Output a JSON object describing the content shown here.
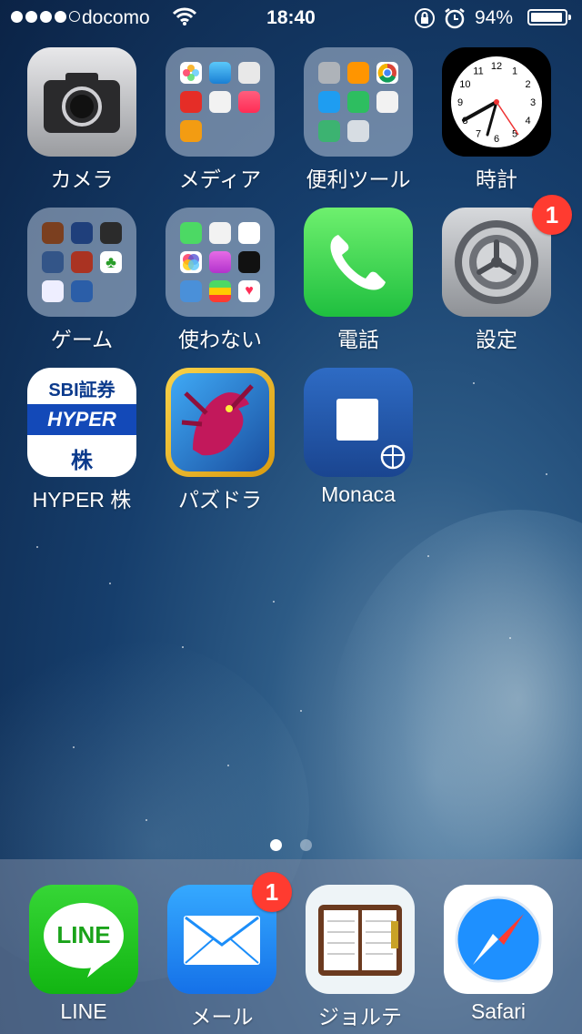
{
  "status_bar": {
    "carrier": "docomo",
    "time": "18:40",
    "battery_percent": "94%",
    "battery_level": 0.94
  },
  "home": {
    "apps": [
      {
        "label": "カメラ",
        "icon": "camera-icon"
      },
      {
        "label": "メディア",
        "icon": "folder-icon"
      },
      {
        "label": "便利ツール",
        "icon": "folder-icon"
      },
      {
        "label": "時計",
        "icon": "clock-icon"
      },
      {
        "label": "ゲーム",
        "icon": "folder-icon"
      },
      {
        "label": "使わない",
        "icon": "folder-icon"
      },
      {
        "label": "電話",
        "icon": "phone-icon"
      },
      {
        "label": "設定",
        "icon": "settings-gear-icon",
        "badge": "1"
      },
      {
        "label": "HYPER 株",
        "icon": "sbi-hyper-icon"
      },
      {
        "label": "パズドラ",
        "icon": "dragon-game-icon"
      },
      {
        "label": "Monaca",
        "icon": "monaca-icon"
      }
    ],
    "clock_numbers": [
      "12",
      "1",
      "2",
      "3",
      "4",
      "5",
      "6",
      "7",
      "8",
      "9",
      "10",
      "11"
    ],
    "sbi_logo": {
      "brand": "SBI証券",
      "product": "HYPER",
      "stock": "株"
    }
  },
  "page_indicator": {
    "pages": 2,
    "current": 1
  },
  "dock": {
    "apps": [
      {
        "label": "LINE",
        "icon_text": "LINE",
        "icon": "line-icon"
      },
      {
        "label": "メール",
        "icon": "mail-icon",
        "badge": "1"
      },
      {
        "label": "ジョルテ",
        "icon": "planner-icon"
      },
      {
        "label": "Safari",
        "icon": "compass-icon"
      }
    ]
  },
  "colors": {
    "badge": "#ff3b30",
    "phone_green": "#4cd964",
    "line_green": "#22c325",
    "mail_blue": "#1c8ef9"
  }
}
